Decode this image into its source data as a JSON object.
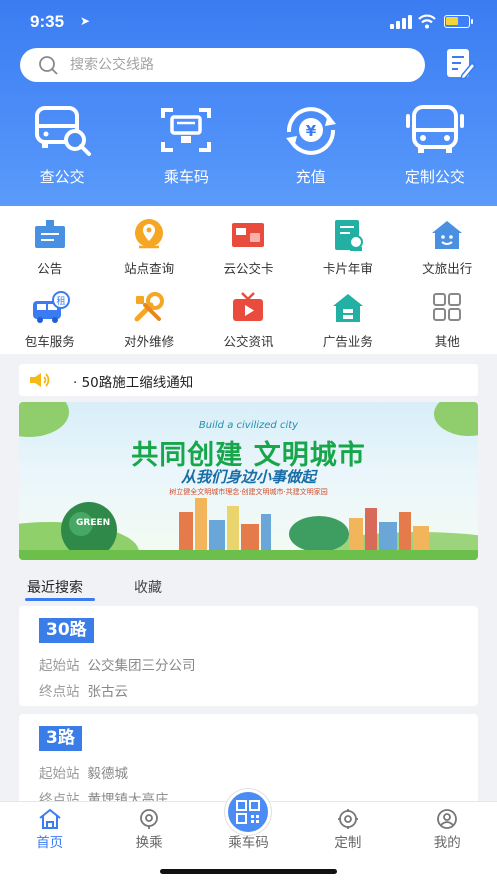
{
  "status_bar": {
    "time": "9:35"
  },
  "search": {
    "placeholder": "搜索公交线路"
  },
  "quick_actions": [
    {
      "label": "查公交",
      "icon": "bus-search-icon"
    },
    {
      "label": "乘车码",
      "icon": "qr-ticket-icon"
    },
    {
      "label": "充值",
      "icon": "yuan-refresh-icon"
    },
    {
      "label": "定制公交",
      "icon": "bus-front-icon"
    }
  ],
  "grid": [
    {
      "label": "公告",
      "icon": "notice-board-icon",
      "color": "#4a90e2"
    },
    {
      "label": "站点查询",
      "icon": "map-pin-icon",
      "color": "#f5a623"
    },
    {
      "label": "云公交卡",
      "icon": "card-icon",
      "color": "#e94b3c"
    },
    {
      "label": "卡片年审",
      "icon": "id-card-icon",
      "color": "#21b0a3"
    },
    {
      "label": "文旅出行",
      "icon": "house-smile-icon",
      "color": "#4a90e2"
    },
    {
      "label": "包车服务",
      "icon": "rent-car-icon",
      "color": "#3b7cf2"
    },
    {
      "label": "对外维修",
      "icon": "repair-icon",
      "color": "#f5a623"
    },
    {
      "label": "公交资讯",
      "icon": "tv-icon",
      "color": "#e94b3c"
    },
    {
      "label": "广告业务",
      "icon": "ad-house-icon",
      "color": "#21b0a3"
    },
    {
      "label": "其他",
      "icon": "grid-icon",
      "color": "#888888"
    }
  ],
  "notice": {
    "text": "· 50路施工缩线通知"
  },
  "banner": {
    "english": "Build a civilized city",
    "title": "共同创建  文明城市",
    "subtitle": "从我们身边小事做起",
    "small_text": "树立健全文明城市理念·创建文明城市·共建文明家园",
    "globe_text": "GREEN"
  },
  "tabs": {
    "recent": "最近搜索",
    "favorites": "收藏"
  },
  "routes": [
    {
      "name": "30路",
      "start_label": "起始站",
      "start": "公交集团三分公司",
      "end_label": "终点站",
      "end": "张古云"
    },
    {
      "name": "3路",
      "start_label": "起始站",
      "start": "毅德城",
      "end_label": "终点站",
      "end": "黄埋镇大高庄"
    }
  ],
  "tabbar": [
    {
      "label": "首页",
      "icon": "home-icon",
      "active": true
    },
    {
      "label": "换乘",
      "icon": "transfer-icon",
      "active": false
    },
    {
      "label": "乘车码",
      "icon": "qr-code-icon",
      "active": false
    },
    {
      "label": "定制",
      "icon": "custom-icon",
      "active": false
    },
    {
      "label": "我的",
      "icon": "profile-icon",
      "active": false
    }
  ]
}
